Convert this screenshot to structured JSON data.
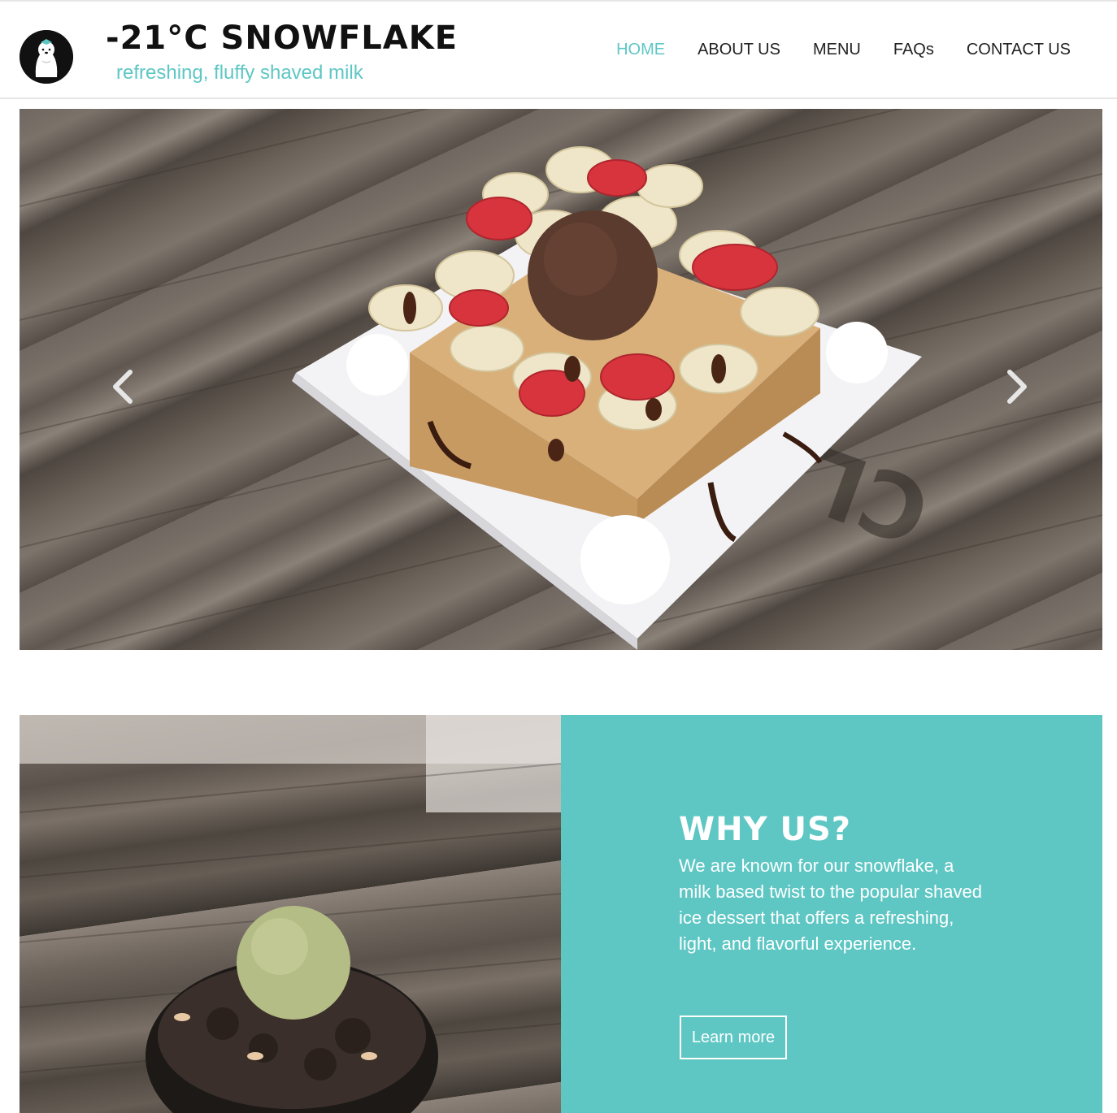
{
  "header": {
    "logo_icon": "polar-bear-logo-icon",
    "brand_title": "-21°C SNOWFLAKE",
    "tagline": "refreshing, fluffy shaved milk"
  },
  "nav": {
    "items": [
      {
        "label": "HOME",
        "active": true
      },
      {
        "label": "ABOUT US",
        "active": false
      },
      {
        "label": "MENU",
        "active": false
      },
      {
        "label": "FAQs",
        "active": false
      },
      {
        "label": "CONTACT US",
        "active": false
      }
    ]
  },
  "carousel": {
    "prev_icon": "chevron-left-icon",
    "next_icon": "chevron-right-icon",
    "slide_image": "honey-toast-banana-strawberry-chocolate-ice-cream-photo"
  },
  "why_us": {
    "image": "matcha-ice-cream-cookie-bowl-photo",
    "heading": "WHY US?",
    "body": "We are known for our snowflake, a milk based twist to the popular shaved ice dessert that offers a refreshing, light, and flavorful experience.",
    "button_label": "Learn more"
  },
  "colors": {
    "accent": "#5ec7c4",
    "text": "#222222",
    "panel_text": "#ffffff"
  }
}
